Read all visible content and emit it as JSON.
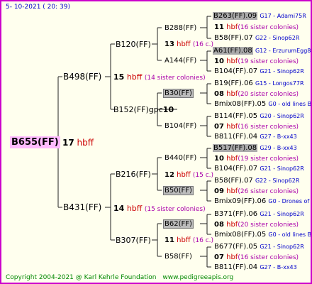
{
  "date": "5- 10-2021 ( 20: 39)",
  "root": {
    "code": "B655(FF)",
    "count": "17",
    "hb": "hbff"
  },
  "gen1": [
    {
      "code": "B498(FF)",
      "count": "15",
      "hb": "hbff",
      "sub": "(14 sister colonies)"
    },
    {
      "code": "B431(FF)",
      "count": "14",
      "hb": "hbff",
      "sub": "(15 sister colonies)"
    }
  ],
  "gen2": [
    {
      "code": "B120(FF)",
      "count": "13",
      "hb": "hbff",
      "sub": "(16 c.)"
    },
    {
      "code": "B152(FF)gpc",
      "count": "10",
      "hb": "",
      "sub": ""
    },
    {
      "code": "B216(FF)",
      "count": "12",
      "hb": "hbff",
      "sub": "(15 c.)"
    },
    {
      "code": "B307(FF)",
      "count": "11",
      "hb": "hbff",
      "sub": "(16 c.)"
    }
  ],
  "gen3": [
    {
      "code": "B288(FF)"
    },
    {
      "code": "A144(FF)"
    },
    {
      "code": "B30(FF)"
    },
    {
      "code": "B104(FF)"
    },
    {
      "code": "B440(FF)"
    },
    {
      "code": "B50(FF)"
    },
    {
      "code": "B62(FF)"
    },
    {
      "code": "B58(FF)"
    }
  ],
  "gen4": [
    {
      "code": "B263(FF).09",
      "info": "G17 - Adami75R"
    },
    {
      "count": "11",
      "hb": "hbf",
      "sub": "(16 sister colonies)"
    },
    {
      "code": "B58(FF).07",
      "info": "G22 - Sinop62R"
    },
    {
      "code": "A61(FF).08",
      "info": "G12 - ErzurumEgg8"
    },
    {
      "count": "10",
      "hb": "hbf",
      "sub": "(19 sister colonies)"
    },
    {
      "code": "B104(FF).07",
      "info": "G21 - Sinop62R"
    },
    {
      "code": "B19(FF).06",
      "info": "G15 - Longos77R"
    },
    {
      "count": "08",
      "hb": "hbf",
      "sub": "(20 sister colonies)"
    },
    {
      "code": "Bmix08(FF).05",
      "info": "G0 - old lines B"
    },
    {
      "code": "B114(FF).05",
      "info": "G20 - Sinop62R"
    },
    {
      "count": "07",
      "hb": "hbf",
      "sub": "(16 sister colonies)"
    },
    {
      "code": "B811(FF).04",
      "info": "G27 - B-xx43"
    },
    {
      "code": "B517(FF).08",
      "info": "G29 - B-xx43"
    },
    {
      "count": "10",
      "hb": "hbf",
      "sub": "(19 sister colonies)"
    },
    {
      "code": "B104(FF).07",
      "info": "G21 - Sinop62R"
    },
    {
      "code": "B58(FF).07",
      "info": "G22 - Sinop62R"
    },
    {
      "count": "09",
      "hb": "hbf",
      "sub": "(26 sister colonies)"
    },
    {
      "code": "Bmix09(FF).06",
      "info": "G0 - Drones of t"
    },
    {
      "code": "B371(FF).06",
      "info": "G21 - Sinop62R"
    },
    {
      "count": "08",
      "hb": "hbf",
      "sub": "(20 sister colonies)"
    },
    {
      "code": "Bmix08(FF).05",
      "info": "G0 - old lines B"
    },
    {
      "code": "B677(FF).05",
      "info": "G21 - Sinop62R"
    },
    {
      "count": "07",
      "hb": "hbf",
      "sub": "(16 sister colonies)"
    },
    {
      "code": "B811(FF).04",
      "info": "G27 - B-xx43"
    }
  ],
  "footer": {
    "copyright": "Copyright 2004-2021 @ Karl Kehrle Foundation",
    "site": "www.pedigreeapis.org"
  }
}
